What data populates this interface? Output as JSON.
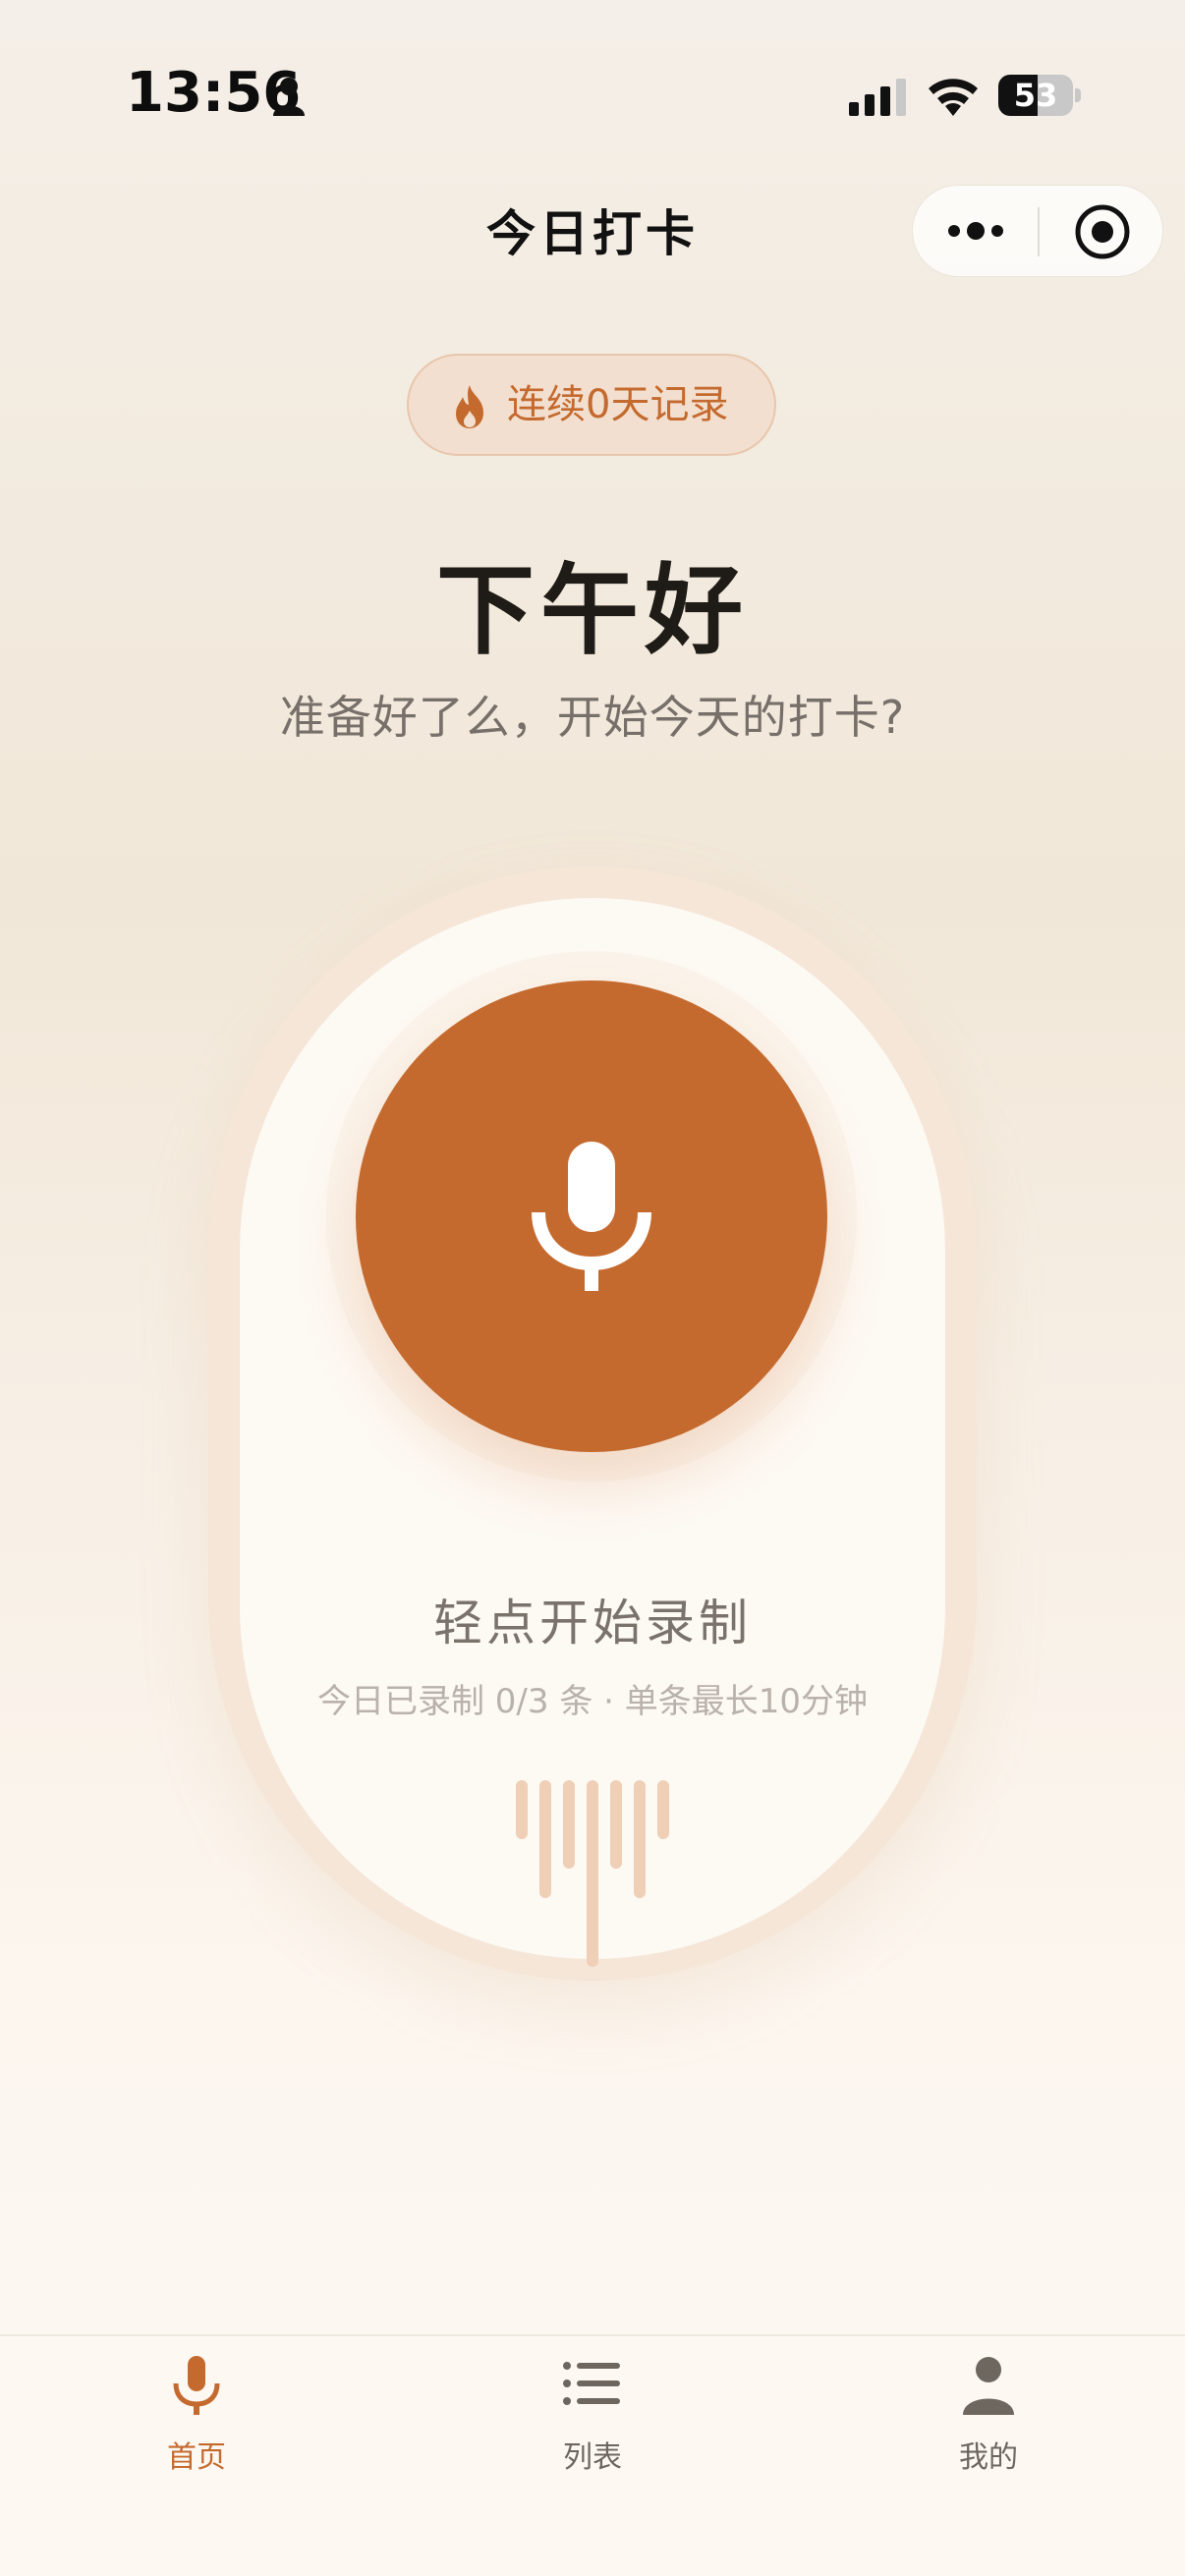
{
  "status_bar": {
    "time": "13:56",
    "battery": "53",
    "battery_percent": 53
  },
  "nav": {
    "title": "今日打卡"
  },
  "streak": {
    "label": "连续0天记录"
  },
  "greeting": {
    "title": "下午好",
    "subtitle": "准备好了么，开始今天的打卡?"
  },
  "recorder": {
    "tap_label": "轻点开始录制",
    "info": "今日已录制 0/3 条 · 单条最长10分钟"
  },
  "tabbar": {
    "items": [
      {
        "label": "首页",
        "icon": "mic-icon",
        "active": true
      },
      {
        "label": "列表",
        "icon": "list-icon",
        "active": false
      },
      {
        "label": "我的",
        "icon": "person-icon",
        "active": false
      }
    ]
  },
  "colors": {
    "accent": "#c56a2e",
    "badge_bg": "#f2dfcf",
    "text_dark": "#1f1b16",
    "text_muted": "#77706a"
  }
}
